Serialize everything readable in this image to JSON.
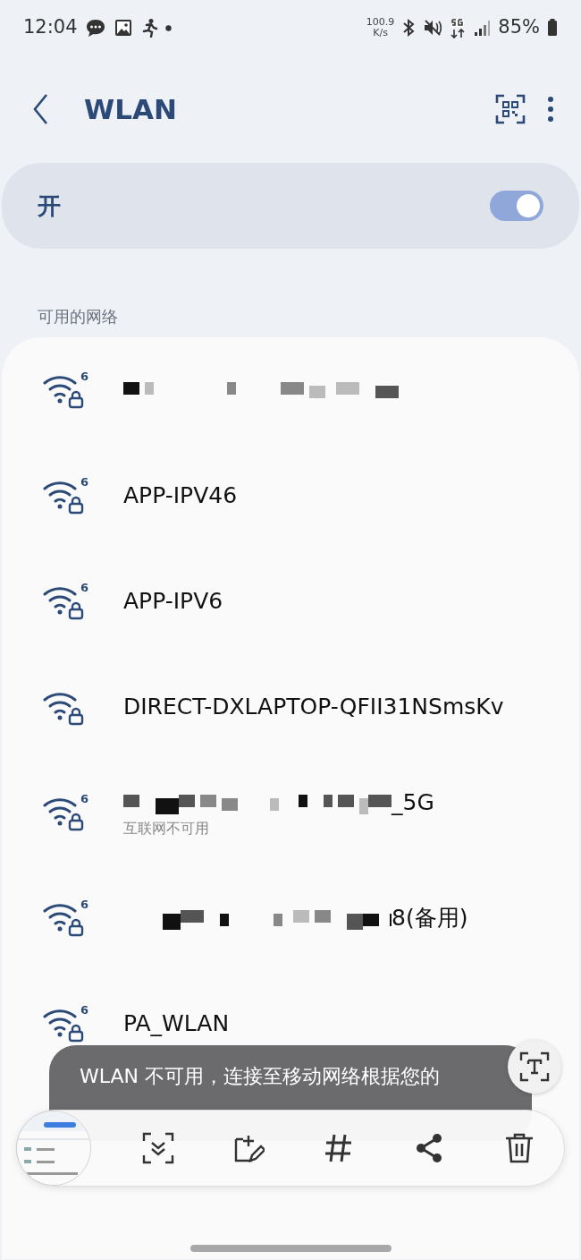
{
  "status_bar": {
    "time": "12:04",
    "speed": "100.9",
    "speed_unit": "K/s",
    "battery": "85%"
  },
  "header": {
    "title": "WLAN"
  },
  "master_switch": {
    "label": "开",
    "on": true
  },
  "section_label": "可用的网络",
  "networks": [
    {
      "redacted": true,
      "wifi6": "6",
      "locked": true
    },
    {
      "name": "APP-IPV46",
      "wifi6": "6",
      "locked": true
    },
    {
      "name": "APP-IPV6",
      "wifi6": "6",
      "locked": true
    },
    {
      "name": "DIRECT-DXLAPTOP-QFII31NSmsKv",
      "locked": true
    },
    {
      "redacted": true,
      "name_tail": "_5G",
      "status": "互联网不可用",
      "wifi6": "6",
      "locked": true
    },
    {
      "redacted": true,
      "name_tail": "8(备用)",
      "wifi6": "6",
      "locked": true
    },
    {
      "name": "PA_WLAN",
      "wifi6": "6",
      "locked": true
    }
  ],
  "toast": {
    "text": "WLAN 不可用，连接至移动网络根据您的"
  }
}
